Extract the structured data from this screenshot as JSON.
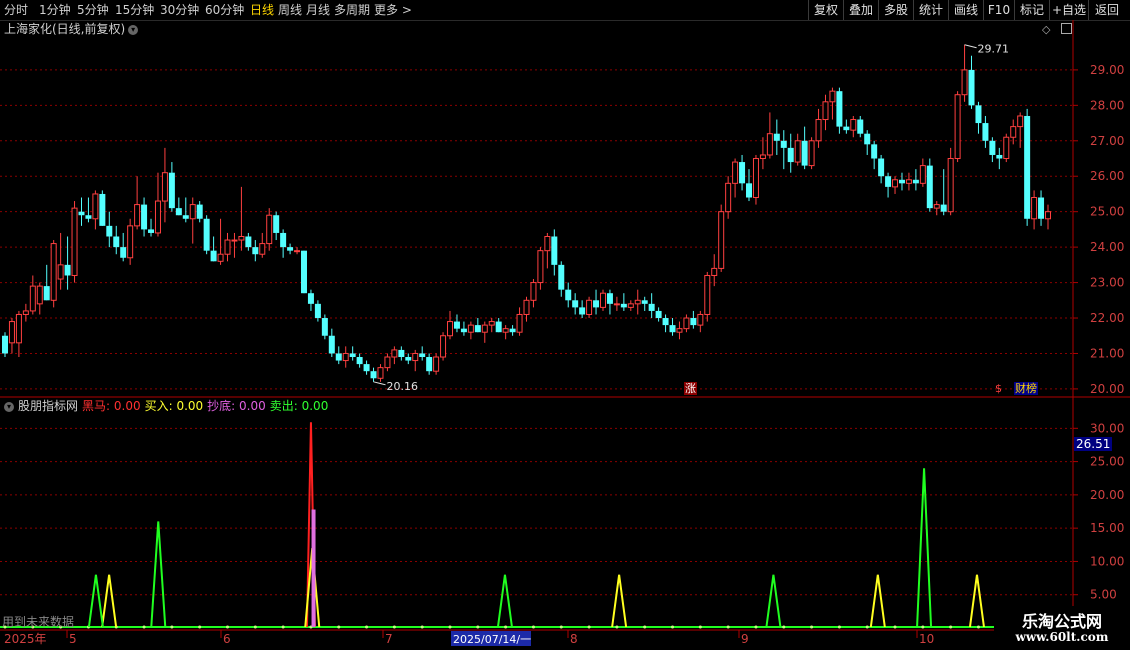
{
  "toolbar": {
    "periods": [
      "分时",
      "1分钟",
      "5分钟",
      "15分钟",
      "30分钟",
      "60分钟",
      "日线",
      "周线",
      "月线",
      "多周期",
      "更多 >"
    ],
    "active_period": "日线",
    "right_buttons": [
      "复权",
      "叠加",
      "多股",
      "统计",
      "画线",
      "F10",
      "标记",
      "+自选",
      "返回"
    ]
  },
  "chart": {
    "title": "上海家化(日线,前复权)",
    "price_axis_labels": [
      "29.00",
      "28.00",
      "27.00",
      "26.00",
      "25.00",
      "24.00",
      "23.00",
      "22.00",
      "21.00",
      "20.00"
    ],
    "high_label": "29.71",
    "low_label": "20.16",
    "badges": {
      "zhang": "涨",
      "dollar": "$",
      "caibao": "财榜"
    }
  },
  "indicator": {
    "name": "股朋指标网",
    "values": [
      {
        "label": "黑马:",
        "value": "0.00",
        "color": "#ff3030"
      },
      {
        "label": "买入:",
        "value": "0.00",
        "color": "#ffff30"
      },
      {
        "label": "抄底:",
        "value": "0.00",
        "color": "#e060e0"
      },
      {
        "label": "卖出:",
        "value": "0.00",
        "color": "#30ff30"
      }
    ],
    "axis_labels": [
      "30.00",
      "25.00",
      "20.00",
      "15.00",
      "10.00",
      "5.00"
    ],
    "current_value": "26.51",
    "note": "用到未来数据"
  },
  "time_axis": {
    "year_label": "2025年",
    "months": [
      "5",
      "6",
      "7",
      "8",
      "9",
      "10"
    ],
    "cursor_date": "2025/07/14/一"
  },
  "watermark": {
    "line1": "乐淘公式网",
    "line2": "www.60lt.com"
  },
  "colors": {
    "up": "#ff4040",
    "down": "#54ffff",
    "grid": "#8b0000",
    "axis_red": "#b00000",
    "black_horse": "#ff2020",
    "buy": "#ffff20",
    "bottom": "#e070e0",
    "sell": "#20ff20"
  },
  "chart_data": {
    "type": "candlestick",
    "price_range": [
      19.8,
      29.9
    ],
    "candles_ohlc": [
      [
        21.5,
        21.6,
        20.9,
        21.0
      ],
      [
        21.3,
        22.0,
        21.0,
        21.9
      ],
      [
        21.3,
        22.2,
        20.9,
        22.1
      ],
      [
        22.1,
        22.4,
        21.9,
        22.2
      ],
      [
        22.2,
        23.2,
        22.1,
        22.9
      ],
      [
        22.4,
        23.0,
        22.1,
        22.9
      ],
      [
        22.9,
        23.5,
        22.5,
        22.5
      ],
      [
        22.5,
        24.2,
        22.3,
        24.1
      ],
      [
        23.1,
        24.4,
        22.8,
        23.5
      ],
      [
        23.5,
        24.3,
        22.8,
        23.2
      ],
      [
        23.2,
        25.3,
        23.0,
        25.1
      ],
      [
        25.0,
        25.4,
        24.6,
        24.9
      ],
      [
        24.9,
        25.4,
        24.7,
        24.8
      ],
      [
        24.8,
        25.6,
        24.5,
        25.5
      ],
      [
        25.5,
        25.6,
        24.6,
        24.6
      ],
      [
        24.6,
        25.0,
        24.0,
        24.3
      ],
      [
        24.3,
        24.6,
        23.8,
        24.0
      ],
      [
        24.0,
        24.4,
        23.6,
        23.7
      ],
      [
        23.7,
        24.8,
        23.5,
        24.6
      ],
      [
        24.6,
        26.0,
        24.5,
        25.2
      ],
      [
        25.2,
        25.4,
        24.3,
        24.5
      ],
      [
        24.5,
        24.8,
        24.3,
        24.4
      ],
      [
        24.4,
        26.1,
        24.3,
        25.3
      ],
      [
        25.3,
        26.8,
        24.7,
        26.1
      ],
      [
        26.1,
        26.4,
        25.0,
        25.1
      ],
      [
        25.1,
        25.4,
        24.9,
        24.9
      ],
      [
        24.9,
        25.4,
        24.7,
        24.8
      ],
      [
        24.8,
        25.4,
        24.1,
        25.2
      ],
      [
        25.2,
        25.3,
        24.7,
        24.8
      ],
      [
        24.8,
        24.9,
        23.8,
        23.9
      ],
      [
        23.9,
        24.3,
        23.6,
        23.6
      ],
      [
        23.6,
        24.8,
        23.5,
        23.8
      ],
      [
        23.8,
        24.4,
        23.6,
        24.2
      ],
      [
        24.2,
        24.4,
        23.7,
        24.2
      ],
      [
        24.2,
        25.7,
        23.9,
        24.3
      ],
      [
        24.3,
        24.4,
        23.9,
        24.0
      ],
      [
        24.0,
        24.2,
        23.6,
        23.8
      ],
      [
        23.8,
        24.4,
        23.7,
        24.1
      ],
      [
        24.1,
        25.1,
        23.9,
        24.9
      ],
      [
        24.9,
        25.0,
        24.2,
        24.4
      ],
      [
        24.4,
        24.5,
        23.7,
        24.0
      ],
      [
        24.0,
        24.1,
        23.8,
        23.9
      ],
      [
        23.9,
        24.0,
        23.8,
        23.9
      ],
      [
        23.9,
        23.9,
        22.7,
        22.7
      ],
      [
        22.7,
        22.8,
        22.2,
        22.4
      ],
      [
        22.4,
        22.5,
        21.9,
        22.0
      ],
      [
        22.0,
        22.1,
        21.4,
        21.5
      ],
      [
        21.5,
        21.7,
        20.9,
        21.0
      ],
      [
        21.0,
        21.2,
        20.7,
        20.8
      ],
      [
        20.8,
        21.2,
        20.6,
        21.0
      ],
      [
        21.0,
        21.2,
        20.8,
        20.9
      ],
      [
        20.9,
        21.0,
        20.6,
        20.7
      ],
      [
        20.7,
        20.8,
        20.4,
        20.5
      ],
      [
        20.5,
        20.6,
        20.2,
        20.3
      ],
      [
        20.3,
        20.7,
        20.2,
        20.6
      ],
      [
        20.6,
        21.0,
        20.5,
        20.9
      ],
      [
        20.9,
        21.2,
        20.7,
        21.1
      ],
      [
        21.1,
        21.2,
        20.8,
        20.9
      ],
      [
        20.9,
        21.0,
        20.7,
        20.8
      ],
      [
        20.8,
        21.1,
        20.5,
        21.0
      ],
      [
        21.0,
        21.2,
        20.8,
        20.9
      ],
      [
        20.9,
        21.0,
        20.4,
        20.5
      ],
      [
        20.5,
        21.0,
        20.4,
        20.9
      ],
      [
        20.9,
        21.6,
        20.8,
        21.5
      ],
      [
        21.5,
        22.2,
        21.4,
        21.9
      ],
      [
        21.9,
        22.1,
        21.6,
        21.7
      ],
      [
        21.7,
        21.9,
        21.5,
        21.6
      ],
      [
        21.6,
        21.9,
        21.4,
        21.8
      ],
      [
        21.8,
        22.0,
        21.6,
        21.6
      ],
      [
        21.6,
        21.9,
        21.3,
        21.8
      ],
      [
        21.8,
        22.0,
        21.6,
        21.9
      ],
      [
        21.9,
        22.0,
        21.6,
        21.6
      ],
      [
        21.6,
        21.8,
        21.4,
        21.7
      ],
      [
        21.7,
        21.8,
        21.5,
        21.6
      ],
      [
        21.6,
        22.3,
        21.5,
        22.1
      ],
      [
        22.1,
        22.6,
        21.9,
        22.5
      ],
      [
        22.5,
        23.1,
        22.3,
        23.0
      ],
      [
        23.0,
        24.0,
        22.8,
        23.9
      ],
      [
        23.9,
        24.4,
        23.4,
        24.3
      ],
      [
        24.3,
        24.5,
        23.2,
        23.5
      ],
      [
        23.5,
        23.6,
        22.6,
        22.8
      ],
      [
        22.8,
        23.0,
        22.3,
        22.5
      ],
      [
        22.5,
        22.7,
        22.1,
        22.3
      ],
      [
        22.3,
        22.5,
        22.0,
        22.1
      ],
      [
        22.1,
        22.6,
        22.0,
        22.5
      ],
      [
        22.5,
        22.8,
        22.1,
        22.3
      ],
      [
        22.3,
        22.8,
        22.2,
        22.7
      ],
      [
        22.7,
        22.8,
        22.1,
        22.4
      ],
      [
        22.4,
        22.6,
        22.2,
        22.4
      ],
      [
        22.4,
        22.7,
        22.2,
        22.3
      ],
      [
        22.3,
        22.5,
        22.2,
        22.4
      ],
      [
        22.4,
        22.8,
        22.1,
        22.5
      ],
      [
        22.5,
        22.6,
        22.2,
        22.4
      ],
      [
        22.4,
        22.7,
        22.0,
        22.2
      ],
      [
        22.2,
        22.3,
        21.9,
        22.0
      ],
      [
        22.0,
        22.1,
        21.6,
        21.8
      ],
      [
        21.8,
        22.0,
        21.5,
        21.6
      ],
      [
        21.6,
        21.9,
        21.4,
        21.7
      ],
      [
        21.7,
        22.1,
        21.6,
        22.0
      ],
      [
        22.0,
        22.2,
        21.7,
        21.8
      ],
      [
        21.8,
        22.2,
        21.6,
        22.1
      ],
      [
        22.1,
        23.3,
        21.9,
        23.2
      ],
      [
        23.2,
        23.8,
        22.9,
        23.4
      ],
      [
        23.4,
        25.2,
        23.3,
        25.0
      ],
      [
        25.0,
        26.0,
        24.8,
        25.8
      ],
      [
        25.8,
        26.5,
        25.4,
        26.4
      ],
      [
        26.4,
        26.6,
        25.6,
        25.8
      ],
      [
        25.8,
        26.2,
        25.3,
        25.4
      ],
      [
        25.4,
        26.6,
        25.2,
        26.5
      ],
      [
        26.5,
        27.1,
        26.2,
        26.6
      ],
      [
        26.6,
        27.8,
        26.5,
        27.2
      ],
      [
        27.2,
        27.6,
        26.6,
        27.0
      ],
      [
        27.0,
        27.3,
        26.2,
        26.8
      ],
      [
        26.8,
        27.2,
        26.1,
        26.4
      ],
      [
        26.4,
        27.2,
        26.3,
        27.0
      ],
      [
        27.0,
        27.4,
        26.2,
        26.3
      ],
      [
        26.3,
        27.1,
        26.2,
        27.0
      ],
      [
        27.0,
        27.9,
        26.8,
        27.6
      ],
      [
        27.6,
        28.3,
        27.3,
        28.1
      ],
      [
        28.1,
        28.5,
        27.6,
        28.4
      ],
      [
        28.4,
        28.5,
        27.2,
        27.4
      ],
      [
        27.4,
        27.6,
        27.2,
        27.3
      ],
      [
        27.3,
        27.7,
        27.1,
        27.6
      ],
      [
        27.6,
        27.7,
        27.1,
        27.2
      ],
      [
        27.2,
        27.3,
        26.6,
        26.9
      ],
      [
        26.9,
        27.0,
        26.2,
        26.5
      ],
      [
        26.5,
        26.6,
        25.8,
        26.0
      ],
      [
        26.0,
        26.1,
        25.4,
        25.7
      ],
      [
        25.7,
        26.0,
        25.5,
        25.9
      ],
      [
        25.9,
        26.1,
        25.6,
        25.8
      ],
      [
        25.8,
        26.1,
        25.6,
        25.9
      ],
      [
        25.9,
        26.2,
        25.6,
        25.8
      ],
      [
        25.8,
        26.5,
        25.7,
        26.3
      ],
      [
        26.3,
        26.5,
        25.0,
        25.1
      ],
      [
        25.1,
        25.3,
        24.9,
        25.2
      ],
      [
        25.2,
        26.2,
        24.9,
        25.0
      ],
      [
        25.0,
        26.8,
        24.9,
        26.5
      ],
      [
        26.5,
        28.4,
        26.4,
        28.3
      ],
      [
        28.3,
        29.71,
        28.1,
        29.0
      ],
      [
        29.0,
        29.4,
        27.9,
        28.0
      ],
      [
        28.0,
        28.1,
        27.2,
        27.5
      ],
      [
        27.5,
        27.7,
        26.8,
        27.0
      ],
      [
        27.0,
        27.1,
        26.4,
        26.6
      ],
      [
        26.6,
        26.8,
        26.2,
        26.5
      ],
      [
        26.5,
        27.2,
        26.4,
        27.1
      ],
      [
        27.1,
        27.6,
        26.9,
        27.4
      ],
      [
        27.4,
        27.8,
        26.8,
        27.7
      ],
      [
        27.7,
        27.9,
        24.6,
        24.8
      ],
      [
        24.8,
        25.6,
        24.5,
        25.4
      ],
      [
        25.4,
        25.6,
        24.6,
        24.8
      ],
      [
        24.8,
        25.2,
        24.5,
        25.0
      ]
    ],
    "indicator_series": [
      {
        "name": "黑马",
        "peaks": [
          {
            "x": 0.2898,
            "value": 30.9
          }
        ]
      },
      {
        "name": "买入",
        "peaks": [
          {
            "x": 0.1017,
            "value": 8.0
          },
          {
            "x": 0.291,
            "value": 12.0
          },
          {
            "x": 0.577,
            "value": 8.0
          },
          {
            "x": 0.8181,
            "value": 8.0
          },
          {
            "x": 0.9105,
            "value": 8.0
          }
        ]
      },
      {
        "name": "抄底",
        "peaks": [
          {
            "x": 0.2922,
            "value": 17.8
          }
        ]
      },
      {
        "name": "卖出",
        "peaks": [
          {
            "x": 0.0894,
            "value": 8.0
          },
          {
            "x": 0.1475,
            "value": 16.0
          },
          {
            "x": 0.4706,
            "value": 8.0
          },
          {
            "x": 0.7208,
            "value": 8.0
          },
          {
            "x": 0.8612,
            "value": 24.0
          }
        ]
      }
    ],
    "indicator_range": [
      0,
      32
    ]
  }
}
